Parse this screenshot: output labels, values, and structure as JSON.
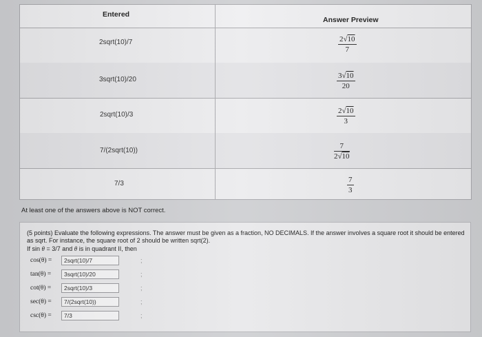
{
  "table": {
    "header_entered": "Entered",
    "header_preview": "Answer Preview",
    "rows": [
      {
        "entered": "2sqrt(10)/7",
        "preview_num_coef": "2",
        "preview_num_rad": "10",
        "preview_num_plain": "",
        "preview_den": "7",
        "preview_den_coef": "",
        "preview_den_rad": ""
      },
      {
        "entered": "3sqrt(10)/20",
        "preview_num_coef": "3",
        "preview_num_rad": "10",
        "preview_num_plain": "",
        "preview_den": "20",
        "preview_den_coef": "",
        "preview_den_rad": ""
      },
      {
        "entered": "2sqrt(10)/3",
        "preview_num_coef": "2",
        "preview_num_rad": "10",
        "preview_num_plain": "",
        "preview_den": "3",
        "preview_den_coef": "",
        "preview_den_rad": ""
      },
      {
        "entered": "7/(2sqrt(10))",
        "preview_num_coef": "",
        "preview_num_rad": "",
        "preview_num_plain": "7",
        "preview_den": "",
        "preview_den_coef": "2",
        "preview_den_rad": "10"
      },
      {
        "entered": "7/3",
        "preview_num_coef": "",
        "preview_num_rad": "",
        "preview_num_plain": "7",
        "preview_den": "3",
        "preview_den_coef": "",
        "preview_den_rad": ""
      }
    ]
  },
  "feedback": "At least one of the answers above is NOT correct.",
  "problem": {
    "instructions": "(5 points) Evaluate the following expressions. The answer must be given as a fraction, NO DECIMALS. If the answer involves a square root it should be entered as sqrt. For instance, the square root of 2 should be written sqrt(2).",
    "given_prefix": "If sin",
    "given_theta": "θ",
    "given_mid": "= 3/7 and",
    "given_theta2": "θ",
    "given_suffix": "is in quadrant II, then",
    "then_text": "",
    "answers": [
      {
        "label": "cos(θ) =",
        "value": "2sqrt(10)/7",
        "semi": ";"
      },
      {
        "label": "tan(θ) =",
        "value": "3sqrt(10)/20",
        "semi": ";"
      },
      {
        "label": "cot(θ) =",
        "value": "2sqrt(10)/3",
        "semi": ";"
      },
      {
        "label": "sec(θ) =",
        "value": "7/(2sqrt(10))",
        "semi": ";"
      },
      {
        "label": "csc(θ) =",
        "value": "7/3",
        "semi": ";"
      }
    ]
  }
}
